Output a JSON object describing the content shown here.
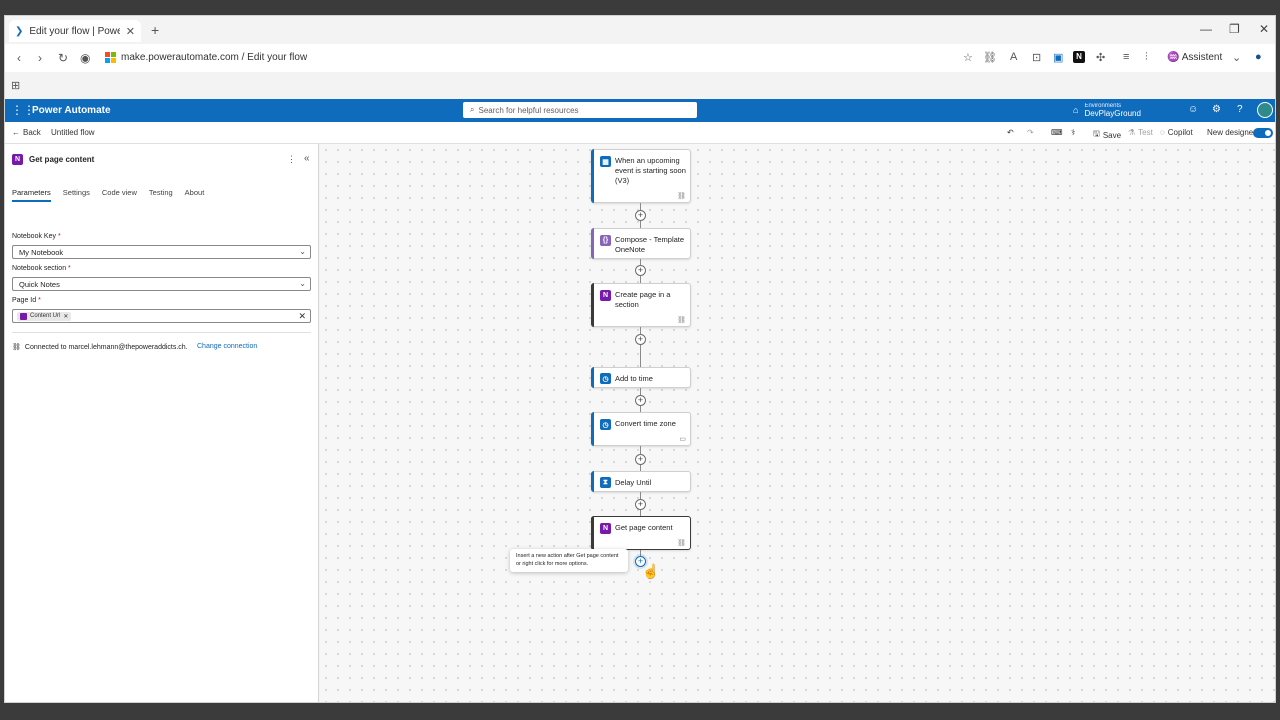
{
  "browser": {
    "tab_title": "Edit your flow | Power Automate",
    "url": "make.powerautomate.com / Edit your flow",
    "assistant_label": "Assistent",
    "ext_badge": "N"
  },
  "header": {
    "app_name": "Power Automate",
    "search_placeholder": "Search for helpful resources",
    "env_label": "Environments",
    "env_name": "DevPlayGround"
  },
  "cmdbar": {
    "back_label": "Back",
    "flow_name": "Untitled flow",
    "save_label": "Save",
    "test_label": "Test",
    "copilot_label": "Copilot",
    "new_designer_label": "New designer"
  },
  "panel": {
    "title": "Get page content",
    "tabs": [
      {
        "label": "Parameters"
      },
      {
        "label": "Settings"
      },
      {
        "label": "Code view"
      },
      {
        "label": "Testing"
      },
      {
        "label": "About"
      }
    ],
    "fields": {
      "notebook_key_label": "Notebook Key",
      "notebook_key_value": "My Notebook",
      "notebook_section_label": "Notebook section",
      "notebook_section_value": "Quick Notes",
      "page_id_label": "Page Id",
      "page_id_token": "Content Url"
    },
    "required_marker": "*",
    "connection_text": "Connected to marcel.lehmann@thepoweraddicts.ch.",
    "change_connection": "Change connection"
  },
  "flow": {
    "steps": [
      {
        "title": "When an upcoming event is starting soon (V3)",
        "icon": "calendar-icon",
        "color": "#0f6cbd"
      },
      {
        "title": "Compose - Template OneNote",
        "icon": "compose-icon",
        "color": "#8764b8"
      },
      {
        "title": "Create page in a section",
        "icon": "onenote-icon",
        "color": "#7719aa"
      },
      {
        "title": "Add to time",
        "icon": "clock-icon",
        "color": "#0f6cbd"
      },
      {
        "title": "Convert time zone",
        "icon": "clock-icon",
        "color": "#0f6cbd"
      },
      {
        "title": "Delay Until",
        "icon": "timer-icon",
        "color": "#0f6cbd"
      },
      {
        "title": "Get page content",
        "icon": "onenote-icon",
        "color": "#7719aa"
      }
    ],
    "tooltip": "Insert a new action after Get page content or right click for more options."
  }
}
